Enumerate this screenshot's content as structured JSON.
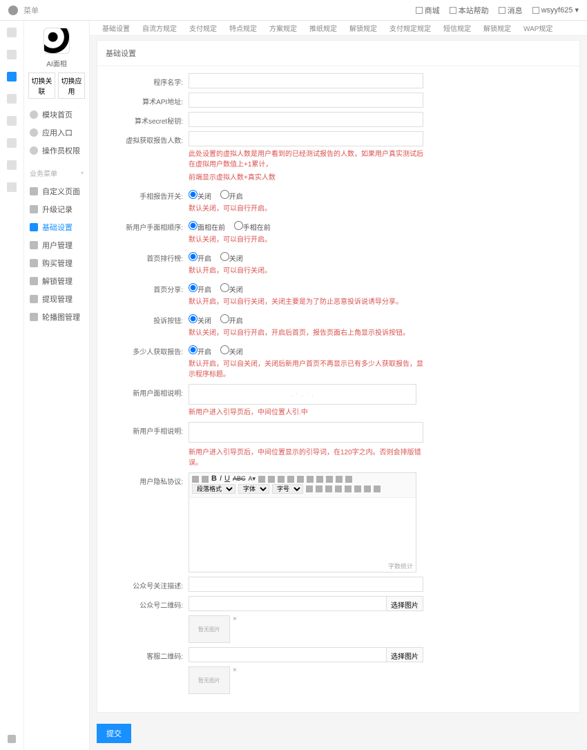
{
  "topbar": {
    "menu": "菜单",
    "mall": "商城",
    "help": "本站帮助",
    "msg": "消息",
    "user": "wsyyf625"
  },
  "sidebar": {
    "appname": "AI面相",
    "switch1": "切换关联",
    "switch2": "切换应用",
    "top_items": [
      "模块首页",
      "应用入口",
      "操作员权限"
    ],
    "biz_header": "业务菜单",
    "biz_items": [
      "自定义页面",
      "升级记录",
      "基础设置",
      "用户管理",
      "购买管理",
      "解锁管理",
      "提现管理",
      "轮播图管理"
    ],
    "active_index": 2
  },
  "tabs": [
    "基础设置",
    "自流方规定",
    "支付规定",
    "特点规定",
    "方案规定",
    "推纸规定",
    "解锁规定",
    "支付规定规定",
    "短信规定",
    "解锁规定",
    "WAP规定"
  ],
  "panel_title": "基础设置",
  "form": {
    "program_name": {
      "label": "程序名字:"
    },
    "api_key": {
      "label": "算术API地址:"
    },
    "secret": {
      "label": "算术secret秘钥:"
    },
    "virtual_count": {
      "label": "虚拟获取报告人数:",
      "hint1": "此处设置的虚拟人数是用户看到的已经测试报告的人数，如果用户真实测试后在虚拟用户数值上+1累计，",
      "hint2": "前端显示虚拟人数+真实人数"
    },
    "report_switch": {
      "label": "手相报告开关:",
      "opts": [
        "关闭",
        "开启"
      ],
      "hint": "默认关闭，可以自行开启。"
    },
    "order": {
      "label": "新用户手面相顺序:",
      "opts": [
        "面相在前",
        "手相在前"
      ],
      "hint": "默认关闭，可以自行开启。"
    },
    "rank": {
      "label": "首页排行榜:",
      "opts": [
        "开启",
        "关闭"
      ],
      "hint": "默认开启，可以自行关闭。"
    },
    "share": {
      "label": "首页分享:",
      "opts": [
        "开启",
        "关闭"
      ],
      "hint": "默认开启，可以自行关闭，关闭主要是为了防止恶意投诉说诱导分享。"
    },
    "complaint": {
      "label": "投诉按钮:",
      "opts": [
        "关闭",
        "开启"
      ],
      "hint": "默认关闭，可以自行开启，开启后首页，报告页面右上角显示投诉按钮。"
    },
    "how_many": {
      "label": "多少人获取报告:",
      "opts": [
        "开启",
        "关闭"
      ],
      "hint": "默认开启，可以自关闭，关闭后新用户首页不再显示已有多少人获取报告，显示程序标题。"
    },
    "face_desc": {
      "label": "新用户面相说明:",
      "hint": "新用户进入引导页后，中间位置人引.中"
    },
    "hand_desc": {
      "label": "新用户手相说明:",
      "hint": "新用户进入引导页后，中间位置显示的引导词，在120字之内。否则会排版错误。"
    },
    "privacy": {
      "label": "用户隐私协议:",
      "presets": [
        "段落格式",
        "字体",
        "字号"
      ],
      "stats": "字数统计"
    },
    "follow_desc": {
      "label": "公众号关注描述:"
    },
    "qr1": {
      "label": "公众号二维码:",
      "btn": "选择图片",
      "preview": "暂无图片"
    },
    "qr2": {
      "label": "客服二维码:",
      "btn": "选择图片",
      "preview": "暂无图片"
    }
  },
  "submit": "提交"
}
